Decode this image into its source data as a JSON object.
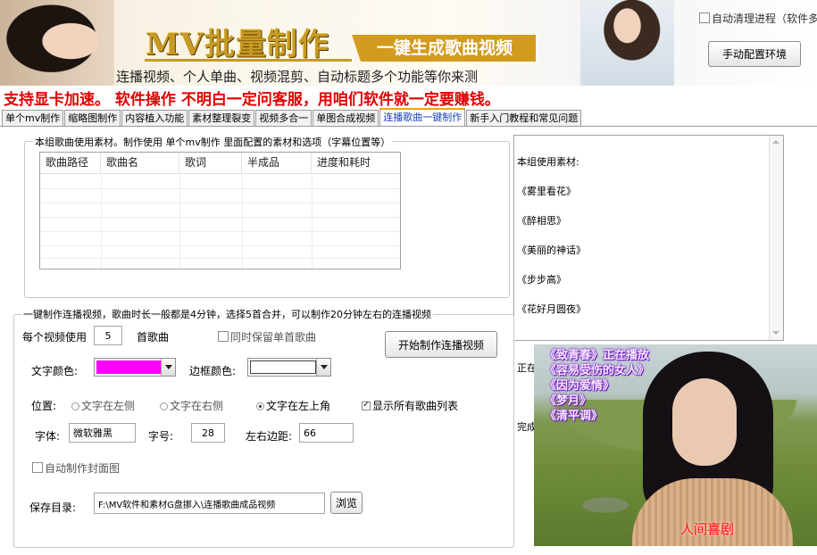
{
  "banner": {
    "title": "MV批量制作",
    "tagline": "一键生成歌曲视频",
    "subtitle": "连播视频、个人单曲、视频混剪、自动标题多个功能等你来测",
    "auto_clean_label": "自动清理进程（软件多",
    "env_button": "手动配置环境"
  },
  "promo": "支持显卡加速。 软件操作 不明白一定问客服，用咱们软件就一定要赚钱。",
  "tabs": [
    {
      "label": "单个mv制作",
      "active": false
    },
    {
      "label": "缩略图制作",
      "active": false
    },
    {
      "label": "内容植入功能",
      "active": false
    },
    {
      "label": "素材整理裂变",
      "active": false
    },
    {
      "label": "视频多合一",
      "active": false
    },
    {
      "label": "单图合成视频",
      "active": false
    },
    {
      "label": "连播歌曲一键制作",
      "active": true
    },
    {
      "label": "新手入门教程和常见问题",
      "active": false
    }
  ],
  "group_materials": {
    "legend": "本组歌曲使用素材。制作使用 单个mv制作 里面配置的素材和选项（字幕位置等）",
    "columns": [
      "歌曲路径",
      "歌曲名",
      "歌词",
      "半成品",
      "进度和耗时"
    ]
  },
  "log": {
    "lines": [
      "本组使用素材:",
      "《雾里看花》",
      "《醉相思》",
      "《美丽的神话》",
      "《步步高》",
      "《花好月圆夜》",
      "",
      "正在合并本组数据",
      "",
      "完成--------"
    ]
  },
  "group_make": {
    "legend": "一键制作连播视频，歌曲时长一般都是4分钟，选择5首合并，可以制作20分钟左右的连播视频",
    "per_video_label": "每个视频使用",
    "per_video_value": "5",
    "per_video_unit": "首歌曲",
    "keep_single_label": "同时保留单首歌曲",
    "start_button": "开始制作连播视频",
    "text_color_label": "文字颜色:",
    "text_color": "#ff00ff",
    "border_color_label": "边框颜色:",
    "border_color": "#ffffff",
    "position_label": "位置:",
    "pos_left": "文字在左侧",
    "pos_right": "文字在右侧",
    "pos_top_left": "文字在左上角",
    "show_all_label": "显示所有歌曲列表",
    "font_label": "字体:",
    "font_value": "微软雅黑",
    "size_label": "字号:",
    "size_value": "28",
    "margin_label": "左右边距:",
    "margin_value": "66",
    "auto_cover_label": "自动制作封面图",
    "save_dir_label": "保存目录:",
    "save_dir_value": "F:\\MV软件和素材G盘挪入\\连播歌曲成品视频",
    "browse_button": "浏览"
  },
  "preview": {
    "songs": [
      "《致青春》正在播放",
      "《容易受伤的女人》",
      "《因为爱情》",
      "《梦月》",
      "《清平调》"
    ],
    "caption": "人间喜剧"
  }
}
